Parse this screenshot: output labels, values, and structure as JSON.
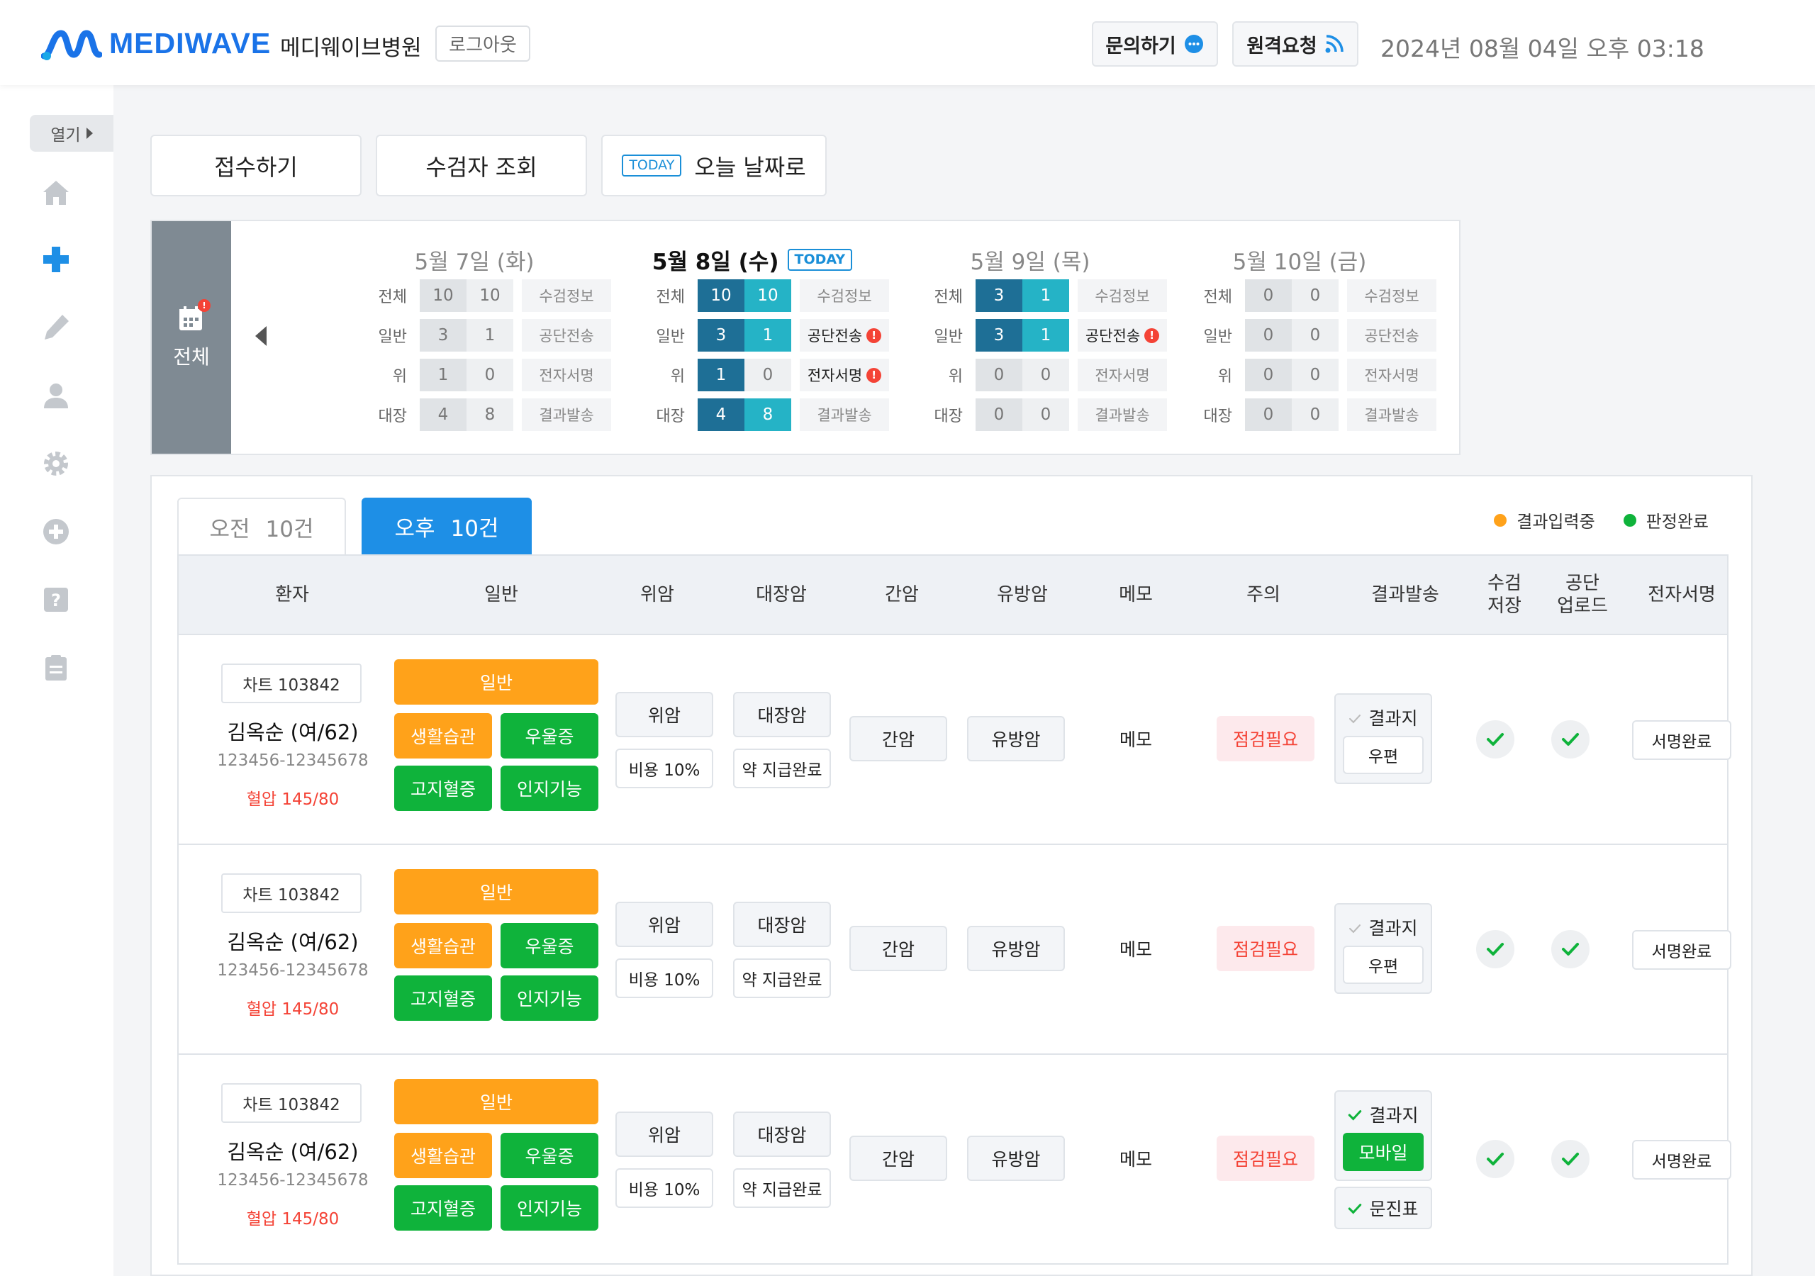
{
  "header": {
    "logo_text": "MEDIWAVE",
    "hospital_name": "메디웨이브병원",
    "logout": "로그아웃",
    "inquiry": "문의하기",
    "remote": "원격요청",
    "datetime": "2024년 08월 04일 오후 03:18"
  },
  "sidebar": {
    "toggle": "열기",
    "icons": [
      "home-icon",
      "plus-icon",
      "pen-icon",
      "user-icon",
      "gear-icon",
      "add-circle-icon",
      "help-icon",
      "clipboard-icon"
    ]
  },
  "actions": {
    "register": "접수하기",
    "search": "수검자 조회",
    "today_tag": "TODAY",
    "today_label": "오늘 날짜로"
  },
  "calendar": {
    "all_label": "전체",
    "row_labels": [
      "전체",
      "일반",
      "위",
      "대장"
    ],
    "today_tag": "TODAY",
    "days": [
      {
        "label": "5월 7일 (화)",
        "today": false,
        "rows": [
          [
            "10",
            "10",
            "수검정보"
          ],
          [
            "3",
            "1",
            "공단전송"
          ],
          [
            "1",
            "0",
            "전자서명"
          ],
          [
            "4",
            "8",
            "결과발송"
          ]
        ]
      },
      {
        "label": "5월 8일 (수)",
        "today": true,
        "rows": [
          [
            "10",
            "10",
            "수검정보"
          ],
          [
            "3",
            "1",
            "공단전송"
          ],
          [
            "1",
            "0",
            "전자서명"
          ],
          [
            "4",
            "8",
            "결과발송"
          ]
        ]
      },
      {
        "label": "5월 9일 (목)",
        "today": false,
        "rows": [
          [
            "3",
            "1",
            "수검정보"
          ],
          [
            "3",
            "1",
            "공단전송"
          ],
          [
            "0",
            "0",
            "전자서명"
          ],
          [
            "0",
            "0",
            "결과발송"
          ]
        ]
      },
      {
        "label": "5월 10일 (금)",
        "today": false,
        "rows": [
          [
            "0",
            "0",
            "수검정보"
          ],
          [
            "0",
            "0",
            "공단전송"
          ],
          [
            "0",
            "0",
            "전자서명"
          ],
          [
            "0",
            "0",
            "결과발송"
          ]
        ]
      }
    ]
  },
  "tabs": {
    "am_label": "오전",
    "am_count": "10건",
    "pm_label": "오후",
    "pm_count": "10건"
  },
  "legend": {
    "in_progress": "결과입력중",
    "in_progress_color": "#ffa21a",
    "done": "판정완료",
    "done_color": "#0fb33b"
  },
  "columns": [
    "환자",
    "일반",
    "위암",
    "대장암",
    "간암",
    "유방암",
    "메모",
    "주의",
    "결과발송",
    "수검\n저장",
    "공단\n업로드",
    "전자서명"
  ],
  "rows": [
    {
      "chart": "차트 103842",
      "name": "김옥순 (여/62)",
      "id": "123456-12345678",
      "bp": "혈압 145/80",
      "general": "일반",
      "habit": "생활습관",
      "depression": "우울증",
      "lipid": "고지혈증",
      "cognitive": "인지기능",
      "stomach": "위암",
      "cost": "비용 10%",
      "colon": "대장암",
      "drug": "약 지급완료",
      "liver": "간암",
      "breast": "유방암",
      "memo": "메모",
      "caution": "점검필요",
      "result_label": "결과지",
      "delivery": "우편",
      "signature": "서명완료"
    },
    {
      "chart": "차트 103842",
      "name": "김옥순 (여/62)",
      "id": "123456-12345678",
      "bp": "혈압 145/80",
      "general": "일반",
      "habit": "생활습관",
      "depression": "우울증",
      "lipid": "고지혈증",
      "cognitive": "인지기능",
      "stomach": "위암",
      "cost": "비용 10%",
      "colon": "대장암",
      "drug": "약 지급완료",
      "liver": "간암",
      "breast": "유방암",
      "memo": "메모",
      "caution": "점검필요",
      "result_label": "결과지",
      "delivery": "우편",
      "signature": "서명완료"
    },
    {
      "chart": "차트 103842",
      "name": "김옥순 (여/62)",
      "id": "123456-12345678",
      "bp": "혈압 145/80",
      "general": "일반",
      "habit": "생활습관",
      "depression": "우울증",
      "lipid": "고지혈증",
      "cognitive": "인지기능",
      "stomach": "위암",
      "cost": "비용 10%",
      "colon": "대장암",
      "drug": "약 지급완료",
      "liver": "간암",
      "breast": "유방암",
      "memo": "메모",
      "caution": "점검필요",
      "result_label": "결과지",
      "delivery": "모바일",
      "questionnaire": "문진표",
      "signature": "서명완료"
    }
  ]
}
